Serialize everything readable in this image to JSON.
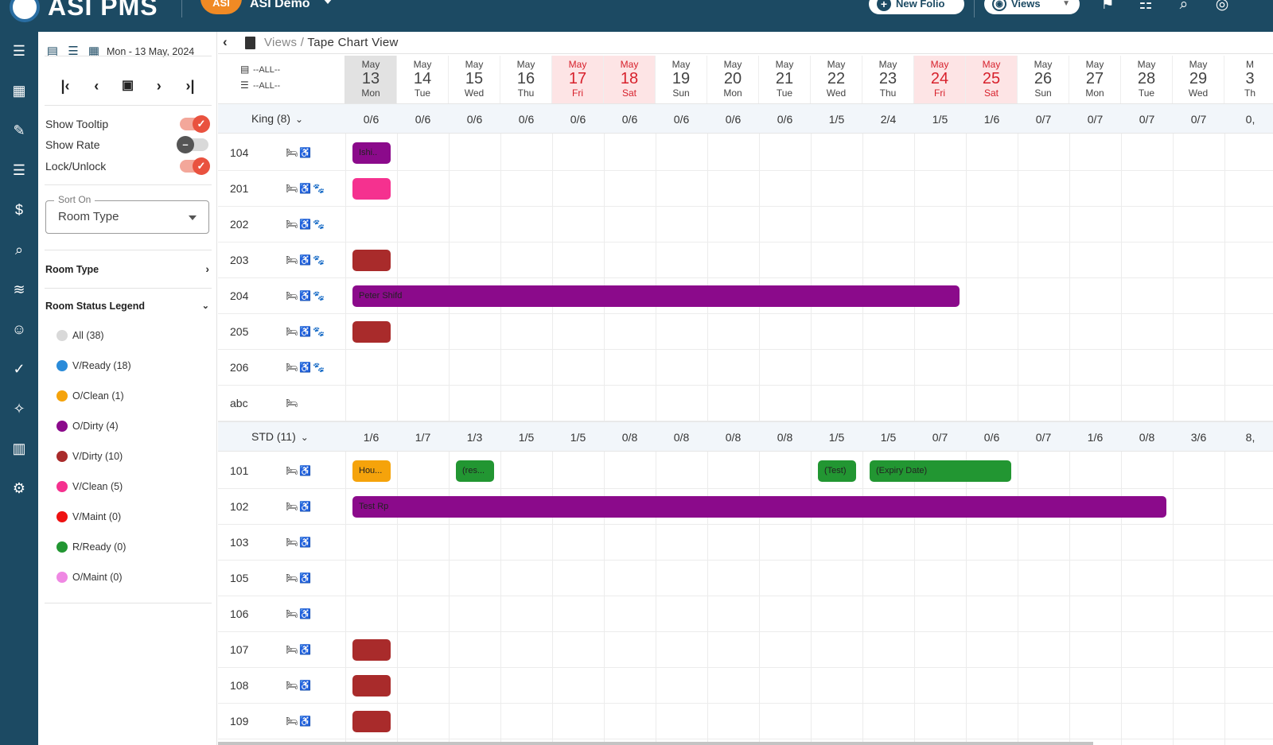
{
  "topbar": {
    "app_name": "ASI PMS",
    "badge": "ASI",
    "property": "ASI Demo",
    "new_folio": "New Folio",
    "views": "Views"
  },
  "sidebar": {
    "date_label": "Mon - 13 May, 2024",
    "toggles": [
      {
        "label": "Show Tooltip",
        "on": true
      },
      {
        "label": "Show Rate",
        "on": false
      },
      {
        "label": "Lock/Unlock",
        "on": true
      }
    ],
    "sort_on": {
      "label": "Sort On",
      "value": "Room Type"
    },
    "room_type_title": "Room Type",
    "legend_title": "Room Status Legend",
    "legend": [
      {
        "label": "All (38)",
        "color": "#d9d9d9"
      },
      {
        "label": "V/Ready (18)",
        "color": "#2a8bd9"
      },
      {
        "label": "O/Clean (1)",
        "color": "#f5a30b"
      },
      {
        "label": "O/Dirty (4)",
        "color": "#8b0a8b"
      },
      {
        "label": "V/Dirty (10)",
        "color": "#a92b2b"
      },
      {
        "label": "V/Clean (5)",
        "color": "#f5318f"
      },
      {
        "label": "V/Maint (0)",
        "color": "#ee1111"
      },
      {
        "label": "R/Ready (0)",
        "color": "#229632"
      },
      {
        "label": "O/Maint (0)",
        "color": "#ef88e3"
      }
    ]
  },
  "breadcrumb": {
    "parent": "Views",
    "separator": "/",
    "current": "Tape Chart View"
  },
  "filters": {
    "line1": "--ALL--",
    "line2": "--ALL--"
  },
  "dates": [
    {
      "m": "May",
      "d": "13",
      "w": "Mon",
      "kind": "today"
    },
    {
      "m": "May",
      "d": "14",
      "w": "Tue",
      "kind": ""
    },
    {
      "m": "May",
      "d": "15",
      "w": "Wed",
      "kind": ""
    },
    {
      "m": "May",
      "d": "16",
      "w": "Thu",
      "kind": ""
    },
    {
      "m": "May",
      "d": "17",
      "w": "Fri",
      "kind": "weekend"
    },
    {
      "m": "May",
      "d": "18",
      "w": "Sat",
      "kind": "weekend"
    },
    {
      "m": "May",
      "d": "19",
      "w": "Sun",
      "kind": ""
    },
    {
      "m": "May",
      "d": "20",
      "w": "Mon",
      "kind": ""
    },
    {
      "m": "May",
      "d": "21",
      "w": "Tue",
      "kind": ""
    },
    {
      "m": "May",
      "d": "22",
      "w": "Wed",
      "kind": ""
    },
    {
      "m": "May",
      "d": "23",
      "w": "Thu",
      "kind": ""
    },
    {
      "m": "May",
      "d": "24",
      "w": "Fri",
      "kind": "weekend"
    },
    {
      "m": "May",
      "d": "25",
      "w": "Sat",
      "kind": "weekend"
    },
    {
      "m": "May",
      "d": "26",
      "w": "Sun",
      "kind": ""
    },
    {
      "m": "May",
      "d": "27",
      "w": "Mon",
      "kind": ""
    },
    {
      "m": "May",
      "d": "28",
      "w": "Tue",
      "kind": ""
    },
    {
      "m": "May",
      "d": "29",
      "w": "Wed",
      "kind": ""
    },
    {
      "m": "M",
      "d": "3",
      "w": "Th",
      "kind": ""
    }
  ],
  "groups": [
    {
      "label": "King (8)",
      "counts": [
        "0/6",
        "0/6",
        "0/6",
        "0/6",
        "0/6",
        "0/6",
        "0/6",
        "0/6",
        "0/6",
        "1/5",
        "2/4",
        "1/5",
        "1/6",
        "0/7",
        "0/7",
        "0/7",
        "0/7",
        "0,"
      ],
      "rooms": [
        {
          "num": "104",
          "icons": "🛏♿",
          "pet": false,
          "bars": [
            {
              "start": 0,
              "days": 1,
              "label": "Ishi..",
              "color": "#8b0a8b"
            }
          ]
        },
        {
          "num": "201",
          "icons": "🛏♿🐾",
          "pet": true,
          "bars": [
            {
              "start": 0,
              "days": 1,
              "label": "",
              "color": "#f5318f"
            }
          ]
        },
        {
          "num": "202",
          "icons": "🛏♿🐾",
          "pet": true,
          "bars": []
        },
        {
          "num": "203",
          "icons": "🛏♿🐾",
          "pet": true,
          "bars": [
            {
              "start": 0,
              "days": 1,
              "label": "",
              "color": "#a92b2b"
            }
          ]
        },
        {
          "num": "204",
          "icons": "🛏♿🐾",
          "pet": true,
          "bars": [
            {
              "start": 0,
              "days": 12,
              "label": "Peter Shifd",
              "color": "#8b0a8b"
            }
          ]
        },
        {
          "num": "205",
          "icons": "🛏♿🐾",
          "pet": true,
          "bars": [
            {
              "start": 0,
              "days": 1,
              "label": "",
              "color": "#a92b2b"
            }
          ]
        },
        {
          "num": "206",
          "icons": "🛏♿🐾",
          "pet": true,
          "bars": []
        },
        {
          "num": "abc",
          "icons": "🛏",
          "pet": false,
          "bars": []
        }
      ]
    },
    {
      "label": "STD (11)",
      "counts": [
        "1/6",
        "1/7",
        "1/3",
        "1/5",
        "1/5",
        "0/8",
        "0/8",
        "0/8",
        "0/8",
        "1/5",
        "1/5",
        "0/7",
        "0/6",
        "0/7",
        "1/6",
        "0/8",
        "3/6",
        "8,"
      ],
      "rooms": [
        {
          "num": "101",
          "icons": "🛏♿",
          "pet": false,
          "bars": [
            {
              "start": 0,
              "days": 1,
              "label": "Hou...",
              "color": "#f5a30b"
            },
            {
              "start": 2,
              "days": 1,
              "label": "(res...",
              "color": "#229632"
            },
            {
              "start": 9,
              "days": 1,
              "label": "(Test)",
              "color": "#229632"
            },
            {
              "start": 10,
              "days": 3,
              "label": "(Expiry Date)",
              "color": "#229632"
            }
          ]
        },
        {
          "num": "102",
          "icons": "🛏♿",
          "pet": false,
          "bars": [
            {
              "start": 0,
              "days": 16,
              "label": "Test Rp",
              "color": "#8b0a8b"
            }
          ]
        },
        {
          "num": "103",
          "icons": "🛏♿",
          "pet": false,
          "bars": []
        },
        {
          "num": "105",
          "icons": "🛏♿",
          "pet": false,
          "bars": []
        },
        {
          "num": "106",
          "icons": "🛏♿",
          "pet": false,
          "bars": []
        },
        {
          "num": "107",
          "icons": "🛏♿",
          "pet": false,
          "bars": [
            {
              "start": 0,
              "days": 1,
              "label": "",
              "color": "#a92b2b"
            }
          ]
        },
        {
          "num": "108",
          "icons": "🛏♿",
          "pet": false,
          "bars": [
            {
              "start": 0,
              "days": 1,
              "label": "",
              "color": "#a92b2b"
            }
          ]
        },
        {
          "num": "109",
          "icons": "🛏♿",
          "pet": false,
          "bars": [
            {
              "start": 0,
              "days": 1,
              "label": "",
              "color": "#a92b2b"
            }
          ]
        }
      ]
    }
  ]
}
